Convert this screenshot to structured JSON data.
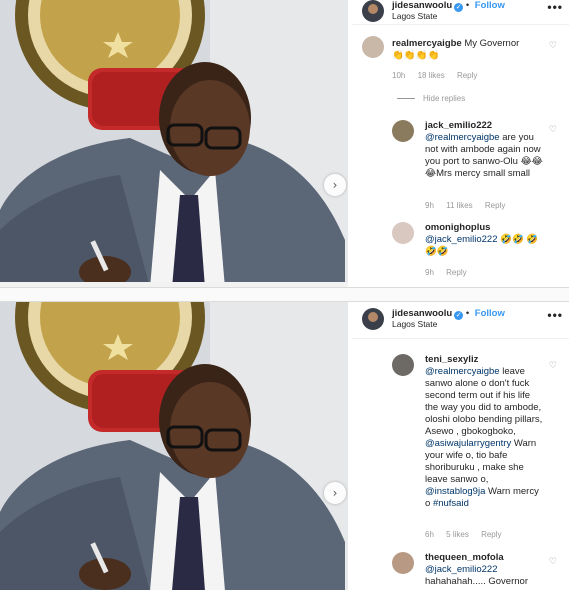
{
  "post1": {
    "header": {
      "username": "jidesanwoolu",
      "verified_glyph": "✓",
      "separator": "•",
      "follow_label": "Follow",
      "location": "Lagos State",
      "more_label": "•••"
    },
    "comments": [
      {
        "username": "realmercyaigbe",
        "text": "My Governor",
        "emoji": "👏👏👏👏",
        "time": "10h",
        "likes": "18 likes",
        "reply": "Reply"
      }
    ],
    "hide_replies": "Hide replies",
    "replies": [
      {
        "username": "jack_emilio222",
        "mention": "@realmercyaigbe",
        "text": " are you not with ambode again now you port to sanwo-Olu 😂😂😂Mrs mercy small small",
        "time": "9h",
        "likes": "11 likes",
        "reply": "Reply"
      },
      {
        "username": "omonighoplus",
        "mention": "@jack_emilio222",
        "text": " 🤣🤣 🤣🤣🤣",
        "time": "9h",
        "reply": "Reply"
      }
    ]
  },
  "post2": {
    "header": {
      "username": "jidesanwoolu",
      "verified_glyph": "✓",
      "separator": "•",
      "follow_label": "Follow",
      "location": "Lagos State",
      "more_label": "•••"
    },
    "comments": [
      {
        "username": "teni_sexyliz",
        "mention": "@realmercyaigbe",
        "text": " leave sanwo alone o don't fuck second term out if his life the way you did to ambode, oloshi olobo bending pillars, Asewo , gbokogboko, ",
        "mention2": "@asiwajularrygentry",
        "text2": " Warn your wife o, tio bafe shoriburuku , make she leave sanwo o, ",
        "mention3": "@instablog9ja",
        "text3": " Warn mercy o ",
        "mention4": "#nufsaid",
        "time": "6h",
        "likes": "5 likes",
        "reply": "Reply"
      },
      {
        "username": "thequeen_mofola",
        "mention": "@jack_emilio222",
        "text": "hahahahah..... Governor"
      }
    ]
  },
  "icons": {
    "heart": "♡",
    "next": "›"
  },
  "colors": {
    "link_blue": "#3897f0",
    "mention_blue": "#003569",
    "meta_gray": "#999999",
    "suit": "#5b6677",
    "chair_red": "#c42a2a"
  }
}
